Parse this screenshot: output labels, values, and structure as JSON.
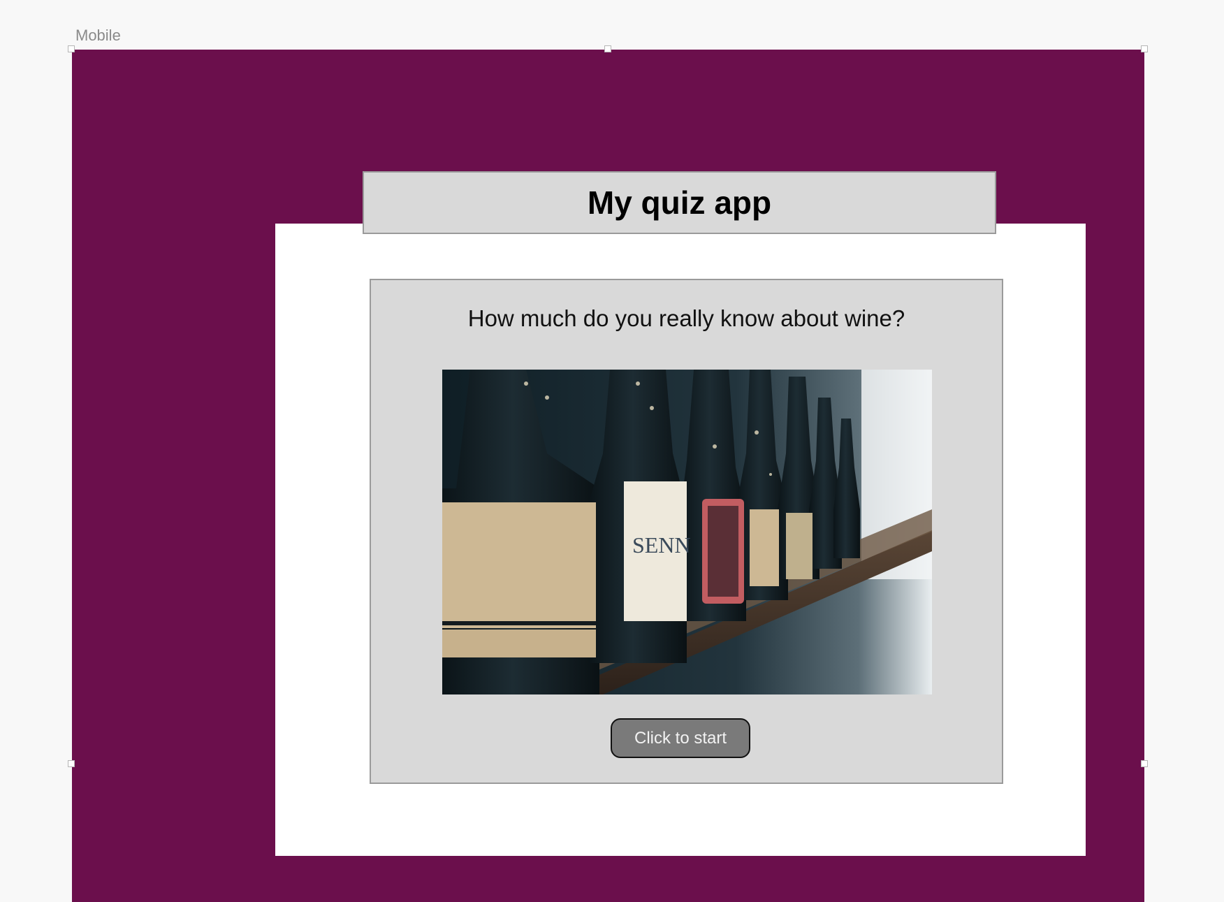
{
  "artboard": {
    "label": "Mobile"
  },
  "app": {
    "title": "My quiz app",
    "subtitle": "How much do you really know about wine?",
    "start_button_label": "Click to start",
    "image_label_text": "SENN"
  },
  "colors": {
    "artboard_bg": "#6b0f4c",
    "panel_bg": "#ffffff",
    "card_bg": "#d9d9d9",
    "button_bg": "#7a7a7a"
  }
}
